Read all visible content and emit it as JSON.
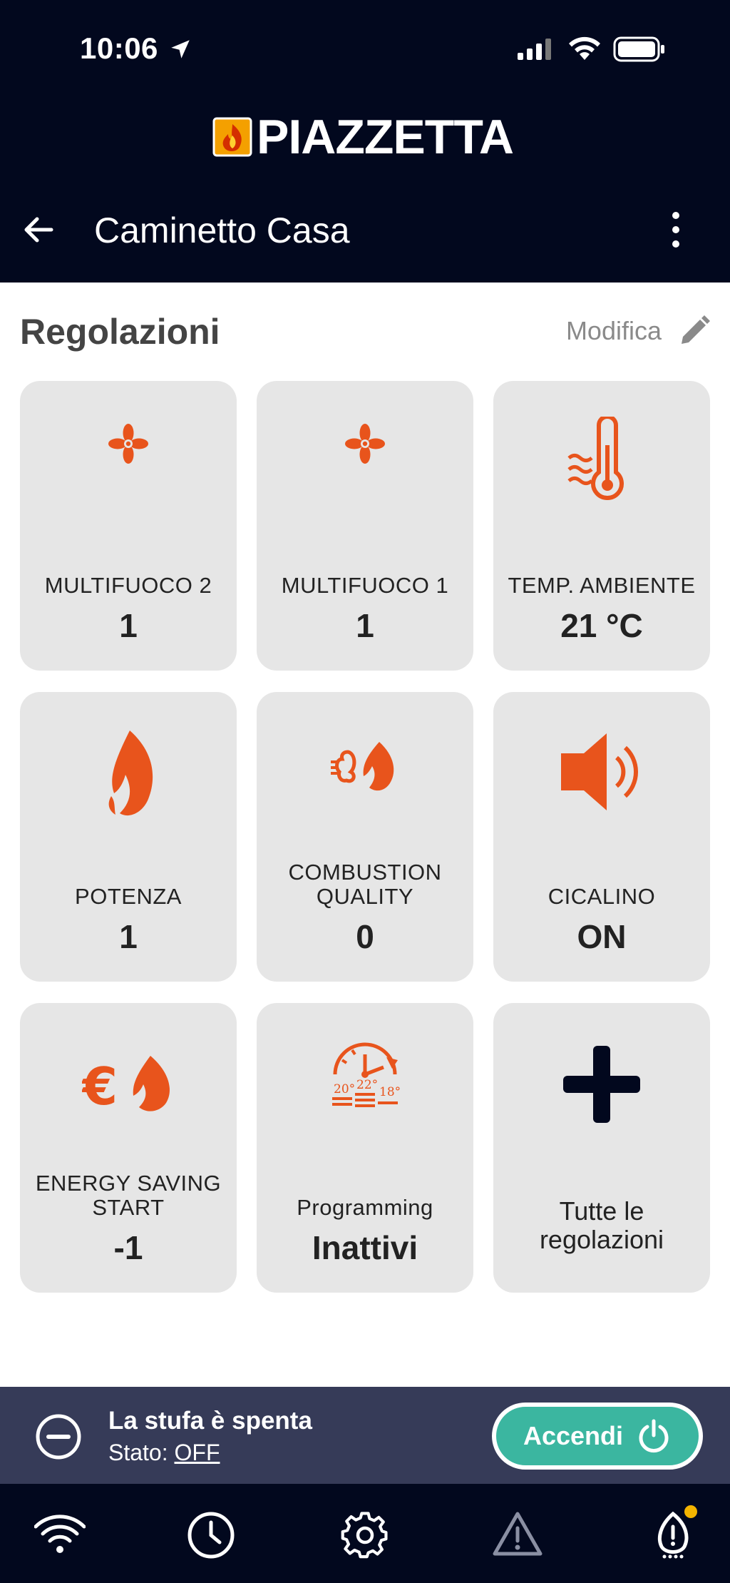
{
  "status_bar": {
    "time": "10:06"
  },
  "brand": {
    "name": "PIAZZETTA"
  },
  "app_bar": {
    "title": "Caminetto Casa"
  },
  "section": {
    "title": "Regolazioni",
    "edit_label": "Modifica"
  },
  "tiles": [
    {
      "label": "MULTIFUOCO 2",
      "value": "1",
      "icon": "fan-icon"
    },
    {
      "label": "MULTIFUOCO 1",
      "value": "1",
      "icon": "fan-icon"
    },
    {
      "label": "TEMP. AMBIENTE",
      "value": "21 °C",
      "icon": "thermometer-icon"
    },
    {
      "label": "POTENZA",
      "value": "1",
      "icon": "flame-icon"
    },
    {
      "label": "COMBUSTION QUALITY",
      "value": "0",
      "icon": "combustion-quality-icon"
    },
    {
      "label": "CICALINO",
      "value": "ON",
      "icon": "speaker-icon"
    },
    {
      "label": "ENERGY SAVING START",
      "value": "-1",
      "icon": "energy-saving-icon"
    },
    {
      "label": "Programming",
      "value": "Inattivi",
      "icon": "programming-icon"
    },
    {
      "label": "Tutte le regolazioni",
      "icon": "plus-icon"
    }
  ],
  "stove_status": {
    "title": "La stufa è spenta",
    "state_label": "Stato:",
    "state_value": "OFF",
    "button_label": "Accendi"
  },
  "tabs": [
    {
      "icon": "wifi-icon"
    },
    {
      "icon": "clock-icon"
    },
    {
      "icon": "gear-icon"
    },
    {
      "icon": "warning-icon"
    },
    {
      "icon": "stove-service-icon",
      "badge": true
    }
  ],
  "colors": {
    "header": "#02081e",
    "accent": "#e8541c",
    "tile": "#e6e6e6",
    "status_panel": "#363b58",
    "button": "#3bb6a0",
    "badge": "#f4b400"
  }
}
